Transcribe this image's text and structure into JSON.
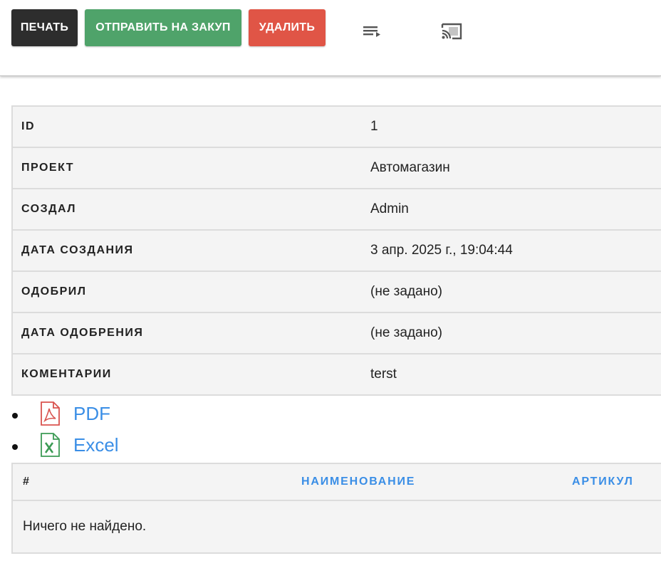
{
  "toolbar": {
    "print_label": "ПЕЧАТЬ",
    "send_label": "ОТПРАВИТЬ НА ЗАКУП",
    "delete_label": "УДАЛИТЬ",
    "icons": [
      "playlist-icon",
      "cast-icon"
    ]
  },
  "details": [
    {
      "label": "ID",
      "value": "1"
    },
    {
      "label": "ПРОЕКТ",
      "value": "Автомагазин"
    },
    {
      "label": "СОЗДАЛ",
      "value": "Admin"
    },
    {
      "label": "ДАТА СОЗДАНИЯ",
      "value": "3 апр. 2025 г., 19:04:44"
    },
    {
      "label": "ОДОБРИЛ",
      "value": "(не задано)"
    },
    {
      "label": "ДАТА ОДОБРЕНИЯ",
      "value": "(не задано)"
    },
    {
      "label": "КОМЕНТАРИИ",
      "value": "terst"
    }
  ],
  "exports": [
    {
      "label": "PDF",
      "icon": "pdf-file-icon",
      "color": "#d9534f"
    },
    {
      "label": "Excel",
      "icon": "excel-file-icon",
      "color": "#3c9b55"
    }
  ],
  "items_table": {
    "columns": [
      "#",
      "НАИМЕНОВАНИЕ",
      "АРТИКУЛ"
    ],
    "empty_text": "Ничего не найдено."
  },
  "colors": {
    "print": "#2d2d2d",
    "send": "#4fa36a",
    "delete": "#e05546",
    "link": "#3a8ee6"
  }
}
